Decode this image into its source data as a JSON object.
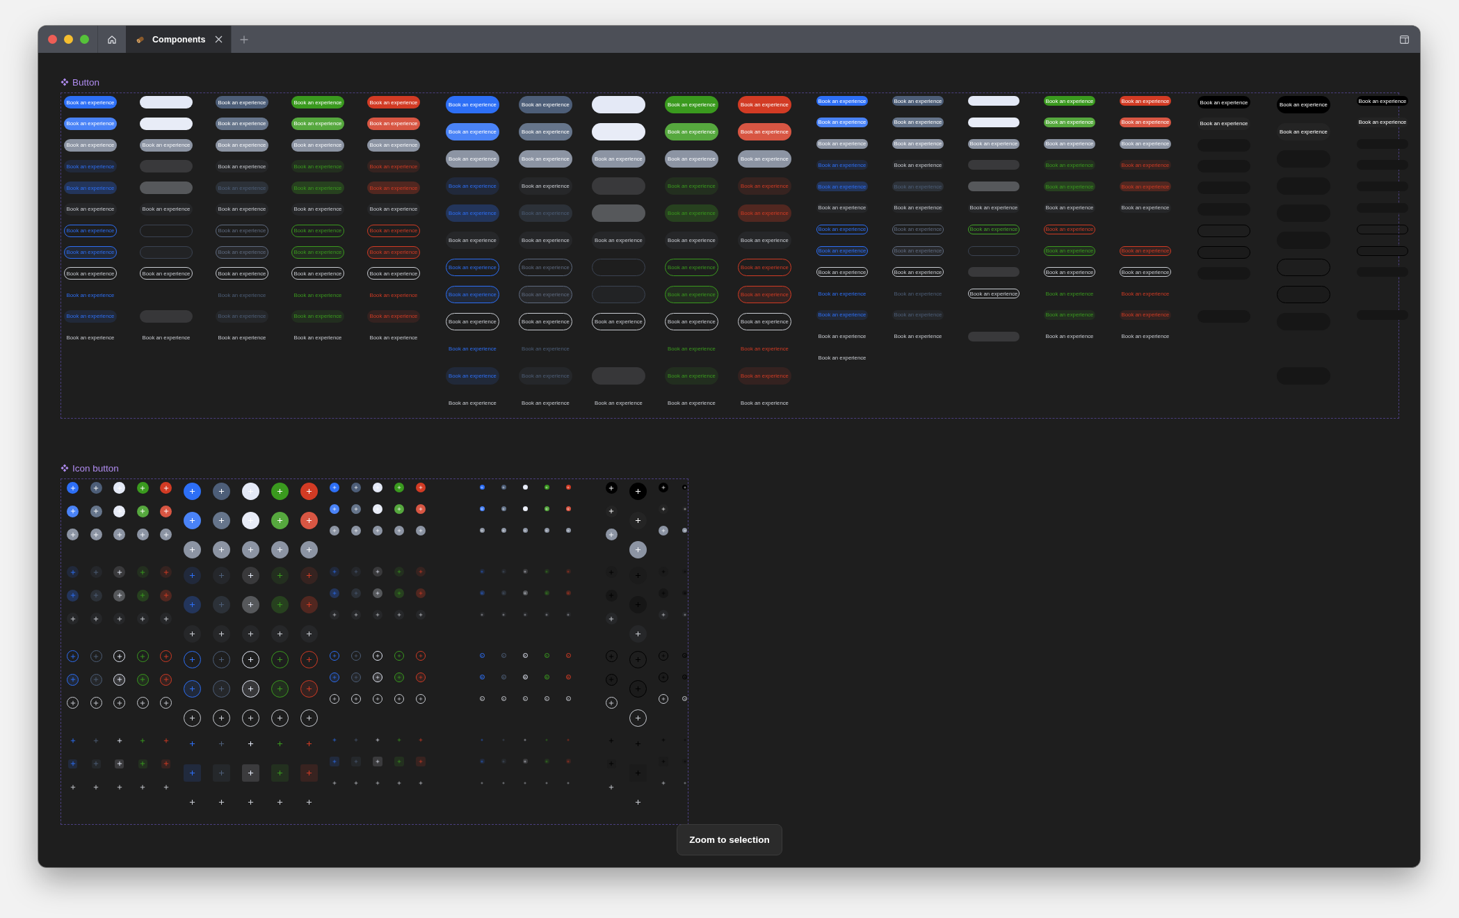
{
  "window": {
    "tabs": [
      {
        "kind": "home",
        "selected": false
      },
      {
        "kind": "document",
        "label": "Components",
        "selected": true
      }
    ]
  },
  "button_section": {
    "title": "Button",
    "groups": [
      {
        "columns": [
          {
            "kind": "sm",
            "color": "#2d6ff6",
            "cells": [
              {
                "kind": "solid",
                "label": "Book an experience"
              },
              {
                "kind": "hover",
                "label": "Book an experience"
              },
              {
                "kind": "disabled",
                "label": "Book an experience"
              },
              {
                "kind": "soft",
                "label": "Book an experience"
              },
              {
                "kind": "soft-hover",
                "label": "Book an experience"
              },
              {
                "kind": "neutral",
                "label": "Book an experience"
              },
              {
                "kind": "outline",
                "label": "Book an experience"
              },
              {
                "kind": "outline-hover",
                "label": "Book an experience"
              },
              {
                "kind": "outline-neutral",
                "label": "Book an experience"
              },
              {
                "kind": "link",
                "label": "Book an experience"
              },
              {
                "kind": "link-bg",
                "label": "Book an experience"
              },
              {
                "kind": "plain",
                "label": "Book an experience"
              }
            ]
          },
          {
            "kind": "sm",
            "color": "#e4e9f6",
            "cells": [
              {
                "kind": "solid"
              },
              {
                "kind": "hover"
              },
              {
                "kind": "disabled",
                "label": "Book an experience"
              },
              {
                "kind": "soft"
              },
              {
                "kind": "soft-hover"
              },
              {
                "kind": "neutral",
                "label": "Book an experience"
              },
              {
                "kind": "outline",
                "color": "#3b4352"
              },
              {
                "kind": "outline-hover",
                "color": "#3b4352"
              },
              {
                "kind": "outline-neutral",
                "label": "Book an experience"
              },
              {
                "kind": "gap"
              },
              {
                "kind": "link-bg"
              },
              {
                "kind": "plain",
                "label": "Book an experience"
              }
            ]
          },
          {
            "kind": "sm",
            "color": "#4d5e78",
            "cells": [
              {
                "kind": "solid",
                "label": "Book an experience"
              },
              {
                "kind": "hover",
                "label": "Book an experience"
              },
              {
                "kind": "disabled",
                "label": "Book an experience"
              },
              {
                "kind": "neutral",
                "label": "Book an experience"
              },
              {
                "kind": "soft-hover",
                "label": "Book an experience"
              },
              {
                "kind": "neutral",
                "label": "Book an experience"
              },
              {
                "kind": "outline",
                "color": "#5f6b80",
                "label": "Book an experience"
              },
              {
                "kind": "outline-hover",
                "color": "#5f6b80",
                "label": "Book an experience"
              },
              {
                "kind": "outline-neutral",
                "label": "Book an experience"
              },
              {
                "kind": "link",
                "label": "Book an experience"
              },
              {
                "kind": "link-bg",
                "label": "Book an experience"
              },
              {
                "kind": "plain",
                "label": "Book an experience"
              }
            ]
          },
          {
            "kind": "sm",
            "color": "#3a9a1e",
            "cells": [
              {
                "kind": "solid",
                "label": "Book an experience"
              },
              {
                "kind": "hover",
                "label": "Book an experience"
              },
              {
                "kind": "disabled",
                "label": "Book an experience"
              },
              {
                "kind": "soft",
                "label": "Book an experience"
              },
              {
                "kind": "soft-hover",
                "label": "Book an experience"
              },
              {
                "kind": "neutral",
                "label": "Book an experience"
              },
              {
                "kind": "outline",
                "label": "Book an experience"
              },
              {
                "kind": "outline-hover",
                "label": "Book an experience"
              },
              {
                "kind": "outline-neutral",
                "label": "Book an experience"
              },
              {
                "kind": "link",
                "label": "Book an experience"
              },
              {
                "kind": "link-bg",
                "label": "Book an experience"
              },
              {
                "kind": "plain",
                "label": "Book an experience"
              }
            ]
          },
          {
            "kind": "sm",
            "color": "#d23b24",
            "cells": [
              {
                "kind": "solid",
                "label": "Book an experience"
              },
              {
                "kind": "hover",
                "label": "Book an experience"
              },
              {
                "kind": "disabled",
                "label": "Book an experience"
              },
              {
                "kind": "soft",
                "label": "Book an experience"
              },
              {
                "kind": "soft-hover",
                "label": "Book an experience"
              },
              {
                "kind": "neutral",
                "label": "Book an experience"
              },
              {
                "kind": "outline",
                "label": "Book an experience"
              },
              {
                "kind": "outline-hover",
                "label": "Book an experience"
              },
              {
                "kind": "outline-neutral",
                "label": "Book an experience"
              },
              {
                "kind": "link",
                "label": "Book an experience"
              },
              {
                "kind": "link-bg",
                "label": "Book an experience"
              },
              {
                "kind": "plain",
                "label": "Book an experience"
              }
            ]
          }
        ]
      },
      {
        "columns": [
          {
            "kind": "lg",
            "color": "#2d6ff6",
            "cells": [
              {
                "kind": "solid",
                "label": "Book an experience"
              },
              {
                "kind": "hover",
                "label": "Book an experience"
              },
              {
                "kind": "disabled",
                "label": "Book an experience"
              },
              {
                "kind": "soft",
                "label": "Book an experience"
              },
              {
                "kind": "soft-hover",
                "label": "Book an experience"
              },
              {
                "kind": "neutral",
                "label": "Book an experience"
              },
              {
                "kind": "outline",
                "label": "Book an experience"
              },
              {
                "kind": "outline-hover",
                "label": "Book an experience"
              },
              {
                "kind": "outline-neutral",
                "label": "Book an experience"
              },
              {
                "kind": "link",
                "label": "Book an experience"
              },
              {
                "kind": "link-bg",
                "label": "Book an experience"
              },
              {
                "kind": "plain",
                "label": "Book an experience"
              }
            ]
          },
          {
            "kind": "lg",
            "color": "#4d5e78",
            "cells": [
              {
                "kind": "solid",
                "label": "Book an experience"
              },
              {
                "kind": "hover",
                "label": "Book an experience"
              },
              {
                "kind": "disabled",
                "label": "Book an experience"
              },
              {
                "kind": "neutral",
                "label": "Book an experience"
              },
              {
                "kind": "soft-hover",
                "label": "Book an experience"
              },
              {
                "kind": "neutral",
                "label": "Book an experience"
              },
              {
                "kind": "outline",
                "color": "#5f6b80",
                "label": "Book an experience"
              },
              {
                "kind": "outline-hover",
                "color": "#5f6b80",
                "label": "Book an experience"
              },
              {
                "kind": "outline-neutral",
                "label": "Book an experience"
              },
              {
                "kind": "link",
                "label": "Book an experience"
              },
              {
                "kind": "link-bg",
                "label": "Book an experience"
              },
              {
                "kind": "plain",
                "label": "Book an experience"
              }
            ]
          },
          {
            "kind": "lg",
            "color": "#e4e9f6",
            "cells": [
              {
                "kind": "solid"
              },
              {
                "kind": "hover"
              },
              {
                "kind": "disabled",
                "label": "Book an experience"
              },
              {
                "kind": "soft"
              },
              {
                "kind": "soft-hover"
              },
              {
                "kind": "neutral",
                "label": "Book an experience"
              },
              {
                "kind": "outline",
                "color": "#3b4352"
              },
              {
                "kind": "outline-hover",
                "color": "#3b4352"
              },
              {
                "kind": "outline-neutral",
                "label": "Book an experience"
              },
              {
                "kind": "gap"
              },
              {
                "kind": "link-bg"
              },
              {
                "kind": "plain",
                "label": "Book an experience"
              }
            ]
          },
          {
            "kind": "lg",
            "color": "#3a9a1e",
            "cells": [
              {
                "kind": "solid",
                "label": "Book an experience"
              },
              {
                "kind": "hover",
                "label": "Book an experience"
              },
              {
                "kind": "disabled",
                "label": "Book an experience"
              },
              {
                "kind": "soft",
                "label": "Book an experience"
              },
              {
                "kind": "soft-hover",
                "label": "Book an experience"
              },
              {
                "kind": "neutral",
                "label": "Book an experience"
              },
              {
                "kind": "outline",
                "label": "Book an experience"
              },
              {
                "kind": "outline-hover",
                "label": "Book an experience"
              },
              {
                "kind": "outline-neutral",
                "label": "Book an experience"
              },
              {
                "kind": "link",
                "label": "Book an experience"
              },
              {
                "kind": "link-bg",
                "label": "Book an experience"
              },
              {
                "kind": "plain",
                "label": "Book an experience"
              }
            ]
          },
          {
            "kind": "lg",
            "color": "#d23b24",
            "cells": [
              {
                "kind": "solid",
                "label": "Book an experience"
              },
              {
                "kind": "hover",
                "label": "Book an experience"
              },
              {
                "kind": "disabled",
                "label": "Book an experience"
              },
              {
                "kind": "soft",
                "label": "Book an experience"
              },
              {
                "kind": "soft-hover",
                "label": "Book an experience"
              },
              {
                "kind": "neutral",
                "label": "Book an experience"
              },
              {
                "kind": "outline",
                "label": "Book an experience"
              },
              {
                "kind": "outline-hover",
                "label": "Book an experience"
              },
              {
                "kind": "outline-neutral",
                "label": "Book an experience"
              },
              {
                "kind": "link",
                "label": "Book an experience"
              },
              {
                "kind": "link-bg",
                "label": "Book an experience"
              },
              {
                "kind": "plain",
                "label": "Book an experience"
              }
            ]
          }
        ]
      },
      {
        "columns": [
          {
            "kind": "xs",
            "color": "#2d6ff6",
            "cells": [
              {
                "kind": "solid",
                "label": "Book an experience"
              },
              {
                "kind": "hover",
                "label": "Book an experience"
              },
              {
                "kind": "disabled",
                "label": "Book an experience"
              },
              {
                "kind": "soft",
                "label": "Book an experience"
              },
              {
                "kind": "soft-hover",
                "label": "Book an experience"
              },
              {
                "kind": "neutral",
                "label": "Book an experience"
              },
              {
                "kind": "outline",
                "label": "Book an experience"
              },
              {
                "kind": "outline-hover",
                "label": "Book an experience"
              },
              {
                "kind": "outline-neutral",
                "label": "Book an experience"
              },
              {
                "kind": "link",
                "label": "Book an experience"
              },
              {
                "kind": "link-bg",
                "label": "Book an experience"
              },
              {
                "kind": "plain",
                "label": "Book an experience"
              },
              {
                "kind": "plain",
                "label": "Book an experience"
              }
            ]
          },
          {
            "kind": "xs",
            "color": "#4d5e78",
            "cells": [
              {
                "kind": "solid",
                "label": "Book an experience"
              },
              {
                "kind": "hover",
                "label": "Book an experience"
              },
              {
                "kind": "disabled",
                "label": "Book an experience"
              },
              {
                "kind": "neutral",
                "label": "Book an experience"
              },
              {
                "kind": "soft-hover",
                "label": "Book an experience"
              },
              {
                "kind": "neutral",
                "label": "Book an experience"
              },
              {
                "kind": "outline",
                "color": "#5f6b80",
                "label": "Book an experience"
              },
              {
                "kind": "outline-hover",
                "color": "#5f6b80",
                "label": "Book an experience"
              },
              {
                "kind": "outline-neutral",
                "label": "Book an experience"
              },
              {
                "kind": "link",
                "label": "Book an experience"
              },
              {
                "kind": "link-bg",
                "label": "Book an experience"
              },
              {
                "kind": "plain",
                "label": "Book an experience"
              }
            ]
          },
          {
            "kind": "xs",
            "color": "#e4e9f6",
            "cells": [
              {
                "kind": "solid"
              },
              {
                "kind": "hover"
              },
              {
                "kind": "disabled",
                "label": "Book an experience"
              },
              {
                "kind": "soft"
              },
              {
                "kind": "soft-hover"
              },
              {
                "kind": "neutral",
                "label": "Book an experience"
              },
              {
                "kind": "outline",
                "color": "#42a527",
                "label": "Book an experience"
              },
              {
                "kind": "outline",
                "color": "#3b4352"
              },
              {
                "kind": "soft"
              },
              {
                "kind": "outline-neutral",
                "label": "Book an experience"
              },
              {
                "kind": "gap"
              },
              {
                "kind": "soft"
              }
            ]
          },
          {
            "kind": "xs",
            "color": "#3a9a1e",
            "cells": [
              {
                "kind": "solid",
                "label": "Book an experience"
              },
              {
                "kind": "hover",
                "label": "Book an experience"
              },
              {
                "kind": "disabled",
                "label": "Book an experience"
              },
              {
                "kind": "soft",
                "label": "Book an experience"
              },
              {
                "kind": "soft-hover",
                "label": "Book an experience"
              },
              {
                "kind": "neutral",
                "label": "Book an experience"
              },
              {
                "kind": "outline",
                "color": "#d23b24",
                "label": "Book an experience"
              },
              {
                "kind": "outline-hover",
                "label": "Book an experience"
              },
              {
                "kind": "outline-neutral",
                "label": "Book an experience"
              },
              {
                "kind": "link",
                "label": "Book an experience"
              },
              {
                "kind": "link-bg",
                "label": "Book an experience"
              },
              {
                "kind": "plain",
                "label": "Book an experience"
              }
            ]
          },
          {
            "kind": "xs",
            "color": "#d23b24",
            "cells": [
              {
                "kind": "solid",
                "label": "Book an experience"
              },
              {
                "kind": "hover",
                "label": "Book an experience"
              },
              {
                "kind": "disabled",
                "label": "Book an experience"
              },
              {
                "kind": "soft",
                "label": "Book an experience"
              },
              {
                "kind": "soft-hover",
                "label": "Book an experience"
              },
              {
                "kind": "neutral",
                "label": "Book an experience"
              },
              {
                "kind": "gap"
              },
              {
                "kind": "outline-hover",
                "label": "Book an experience"
              },
              {
                "kind": "outline-neutral",
                "label": "Book an experience"
              },
              {
                "kind": "link",
                "label": "Book an experience"
              },
              {
                "kind": "link-bg",
                "label": "Book an experience"
              },
              {
                "kind": "plain",
                "label": "Book an experience"
              }
            ]
          }
        ]
      },
      {
        "columns": [
          {
            "kind": "sm",
            "color": "#000000",
            "cells": [
              {
                "kind": "solid",
                "label": "Book an experience"
              },
              {
                "kind": "hover",
                "label": "Book an experience"
              },
              {
                "kind": "soft-hover"
              },
              {
                "kind": "soft-hover"
              },
              {
                "kind": "soft-hover"
              },
              {
                "kind": "soft-hover"
              },
              {
                "kind": "outline"
              },
              {
                "kind": "outline-hover"
              },
              {
                "kind": "soft-hover"
              },
              {
                "kind": "gap"
              },
              {
                "kind": "soft-hover"
              },
              {
                "kind": "gap"
              }
            ]
          },
          {
            "kind": "lg",
            "color": "#000000",
            "cells": [
              {
                "kind": "solid",
                "label": "Book an experience"
              },
              {
                "kind": "hover",
                "label": "Book an experience"
              },
              {
                "kind": "soft-hover"
              },
              {
                "kind": "soft-hover"
              },
              {
                "kind": "soft-hover"
              },
              {
                "kind": "soft-hover"
              },
              {
                "kind": "outline"
              },
              {
                "kind": "outline-hover"
              },
              {
                "kind": "soft-hover"
              },
              {
                "kind": "gap"
              },
              {
                "kind": "soft-hover"
              },
              {
                "kind": "gap"
              }
            ]
          },
          {
            "kind": "xs",
            "color": "#000000",
            "cells": [
              {
                "kind": "solid",
                "label": "Book an experience"
              },
              {
                "kind": "hover",
                "label": "Book an experience"
              },
              {
                "kind": "soft-hover"
              },
              {
                "kind": "soft-hover"
              },
              {
                "kind": "soft-hover"
              },
              {
                "kind": "soft-hover"
              },
              {
                "kind": "outline"
              },
              {
                "kind": "outline-hover"
              },
              {
                "kind": "soft-hover"
              },
              {
                "kind": "gap"
              },
              {
                "kind": "soft-hover"
              },
              {
                "kind": "gap"
              }
            ]
          }
        ]
      }
    ]
  },
  "icon_button_section": {
    "title": "Icon button",
    "rows": [
      {
        "kind": "solid"
      },
      {
        "kind": "hover"
      },
      {
        "kind": "disabled"
      },
      {
        "kind": "soft"
      },
      {
        "kind": "soft-hover"
      },
      {
        "kind": "neutral"
      },
      {
        "kind": "outline"
      },
      {
        "kind": "outline-hover"
      },
      {
        "kind": "outline-neutral"
      },
      {
        "kind": "link"
      },
      {
        "kind": "link-bg"
      },
      {
        "kind": "plain"
      }
    ],
    "groups": [
      {
        "columns": [
          {
            "kind": "sm",
            "color": "#2d6ff6"
          },
          {
            "kind": "sm",
            "color": "#4d5e78"
          },
          {
            "kind": "sm",
            "color": "#e4e9f6"
          },
          {
            "kind": "sm",
            "color": "#3a9a1e"
          },
          {
            "kind": "sm",
            "color": "#d23b24"
          }
        ]
      },
      {
        "columns": [
          {
            "kind": "lg",
            "color": "#2d6ff6"
          },
          {
            "kind": "lg",
            "color": "#4d5e78"
          },
          {
            "kind": "lg",
            "color": "#e4e9f6"
          },
          {
            "kind": "lg",
            "color": "#3a9a1e"
          },
          {
            "kind": "lg",
            "color": "#d23b24"
          }
        ]
      },
      {
        "columns": [
          {
            "kind": "xs",
            "color": "#2d6ff6"
          },
          {
            "kind": "xs",
            "color": "#4d5e78"
          },
          {
            "kind": "xs",
            "color": "#e4e9f6"
          },
          {
            "kind": "xs",
            "color": "#3a9a1e"
          },
          {
            "kind": "xs",
            "color": "#d23b24"
          }
        ]
      },
      {
        "columns": [
          {
            "kind": "xxs",
            "color": "#2d6ff6"
          },
          {
            "kind": "xxs",
            "color": "#4d5e78"
          },
          {
            "kind": "xxs",
            "color": "#e4e9f6"
          },
          {
            "kind": "xxs",
            "color": "#3a9a1e"
          },
          {
            "kind": "xxs",
            "color": "#d23b24"
          }
        ]
      },
      {
        "columns": [
          {
            "kind": "sm",
            "color": "#000000"
          },
          {
            "kind": "lg",
            "color": "#000000"
          },
          {
            "kind": "xs",
            "color": "#000000"
          },
          {
            "kind": "xxs",
            "color": "#000000"
          }
        ]
      }
    ]
  },
  "toast": {
    "label": "Zoom to selection"
  }
}
